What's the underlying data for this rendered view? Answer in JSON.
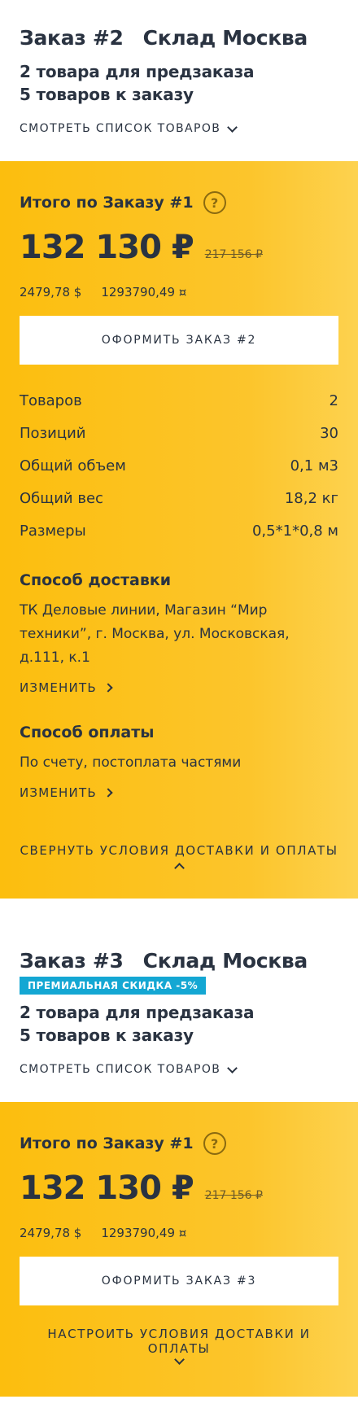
{
  "orders": [
    {
      "title": "Заказ #2",
      "warehouse": "Склад Москва",
      "badge": "",
      "preorder_line": "2 товара для предзаказа",
      "order_line": "5 товаров к заказу",
      "view_list_label": "СМОТРЕТЬ СПИСОК ТОВАРОВ",
      "summary": {
        "total_label": "Итого по Заказу #1",
        "help_icon": "?",
        "price": "132 130 ₽",
        "old_price": "217 156 ₽",
        "usd": "2479,78 $",
        "other_currency": "1293790,49 ¤",
        "checkout_label": "ОФОРМИТЬ ЗАКАЗ #2",
        "stats": [
          {
            "label": "Товаров",
            "value": "2"
          },
          {
            "label": "Позиций",
            "value": "30"
          },
          {
            "label": "Общий объем",
            "value": "0,1 м3"
          },
          {
            "label": "Общий вес",
            "value": "18,2 кг"
          },
          {
            "label": "Размеры",
            "value": "0,5*1*0,8 м"
          }
        ],
        "delivery_title": "Способ доставки",
        "delivery_text": "ТК Деловые линии, Магазин “Мир техники”, г. Москва, ул. Московская, д.111, к.1",
        "delivery_change": "ИЗМЕНИТЬ",
        "payment_title": "Способ оплаты",
        "payment_text": "По счету, постоплата частями",
        "payment_change": "ИЗМЕНИТЬ",
        "toggle_label": "СВЕРНУТЬ УСЛОВИЯ ДОСТАВКИ И ОПЛАТЫ"
      }
    },
    {
      "title": "Заказ #3",
      "warehouse": "Склад Москва",
      "badge": "ПРЕМИАЛЬНАЯ СКИДКА -5%",
      "preorder_line": "2 товара для предзаказа",
      "order_line": "5 товаров к заказу",
      "view_list_label": "СМОТРЕТЬ СПИСОК ТОВАРОВ",
      "summary": {
        "total_label": "Итого по Заказу #1",
        "help_icon": "?",
        "price": "132 130 ₽",
        "old_price": "217 156 ₽",
        "usd": "2479,78 $",
        "other_currency": "1293790,49 ¤",
        "checkout_label": "ОФОРМИТЬ ЗАКАЗ #3",
        "toggle_label": "НАСТРОИТЬ УСЛОВИЯ ДОСТАВКИ И ОПЛАТЫ"
      }
    }
  ],
  "colors": {
    "accent_yellow": "#fcbe0e",
    "badge_blue": "#14a7d3",
    "text_dark": "#2a3341"
  }
}
